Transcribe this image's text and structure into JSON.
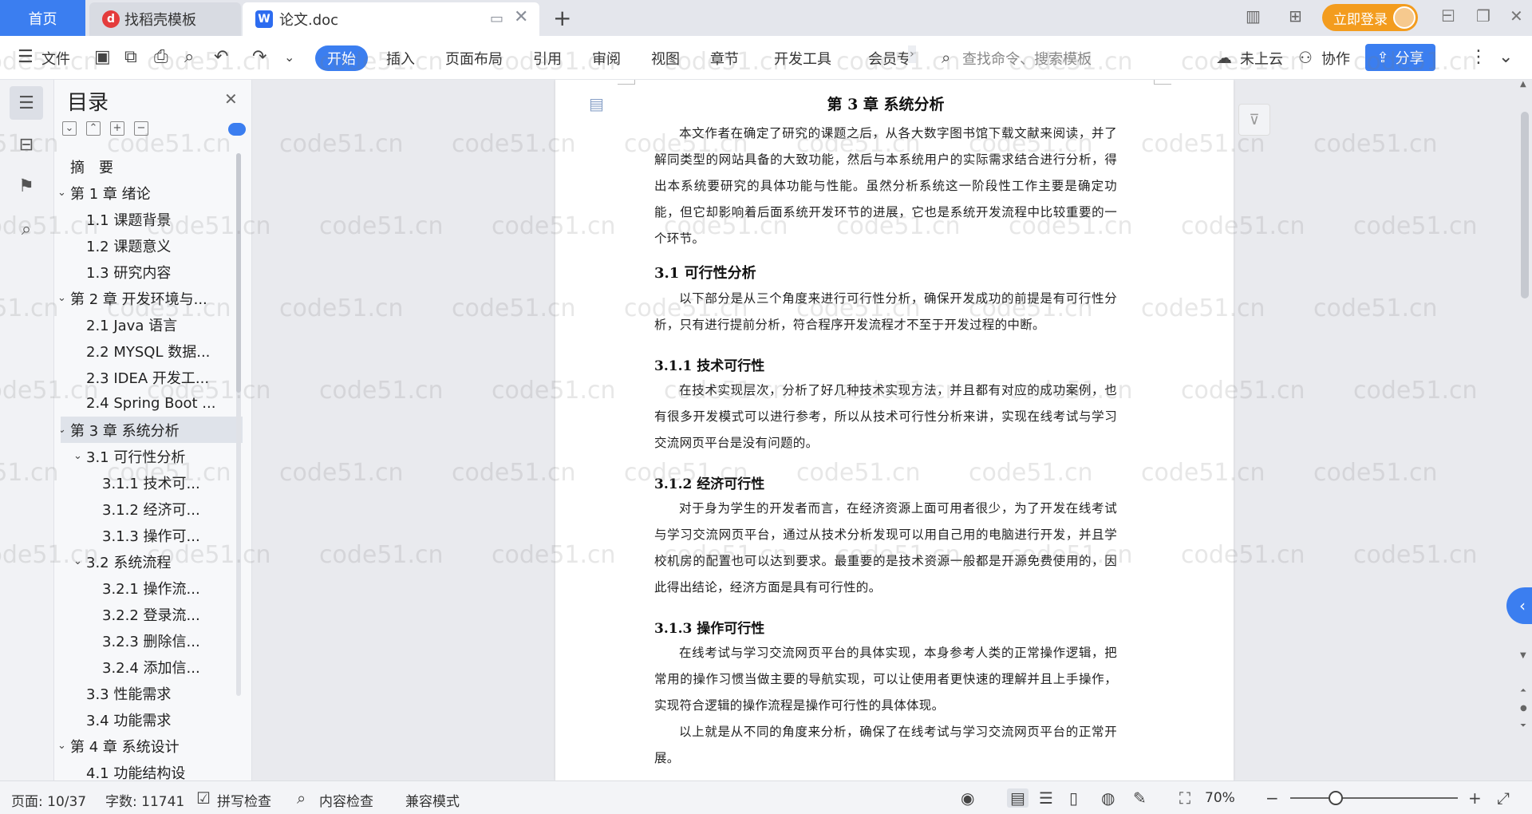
{
  "tabs": {
    "home": "首页",
    "templates": "找稻壳模板",
    "document": "论文.doc",
    "login": "立即登录"
  },
  "ribbon": {
    "file": "文件",
    "start": "开始",
    "menu": [
      "插入",
      "页面布局",
      "引用",
      "审阅",
      "视图",
      "章节",
      "开发工具",
      "会员专"
    ],
    "search_placeholder": "查找命令、搜索模板",
    "cloud": "未上云",
    "collab": "协作",
    "share": "分享"
  },
  "outline": {
    "title": "目录",
    "items": [
      {
        "label": "摘　要",
        "level": 1,
        "caret": false
      },
      {
        "label": "第 1 章  绪论",
        "level": 1,
        "caret": true
      },
      {
        "label": "1.1  课题背景",
        "level": 2,
        "caret": false
      },
      {
        "label": "1.2  课题意义",
        "level": 2,
        "caret": false
      },
      {
        "label": "1.3  研究内容",
        "level": 2,
        "caret": false
      },
      {
        "label": "第 2 章  开发环境与...",
        "level": 1,
        "caret": true
      },
      {
        "label": "2.1 Java 语言",
        "level": 2,
        "caret": false
      },
      {
        "label": "2.2 MYSQL 数据...",
        "level": 2,
        "caret": false
      },
      {
        "label": "2.3 IDEA 开发工...",
        "level": 2,
        "caret": false
      },
      {
        "label": "2.4 Spring Boot ...",
        "level": 2,
        "caret": false
      },
      {
        "label": "第 3 章  系统分析",
        "level": 1,
        "caret": true,
        "active": true
      },
      {
        "label": "3.1  可行性分析",
        "level": 2,
        "caret": true
      },
      {
        "label": "3.1.1  技术可...",
        "level": 3,
        "caret": false
      },
      {
        "label": "3.1.2  经济可...",
        "level": 3,
        "caret": false
      },
      {
        "label": "3.1.3  操作可...",
        "level": 3,
        "caret": false
      },
      {
        "label": "3.2  系统流程",
        "level": 2,
        "caret": true
      },
      {
        "label": "3.2.1  操作流...",
        "level": 3,
        "caret": false
      },
      {
        "label": "3.2.2  登录流...",
        "level": 3,
        "caret": false
      },
      {
        "label": "3.2.3  删除信...",
        "level": 3,
        "caret": false
      },
      {
        "label": "3.2.4  添加信...",
        "level": 3,
        "caret": false
      },
      {
        "label": "3.3  性能需求",
        "level": 2,
        "caret": false
      },
      {
        "label": "3.4  功能需求",
        "level": 2,
        "caret": false
      },
      {
        "label": "第 4 章  系统设计",
        "level": 1,
        "caret": true
      },
      {
        "label": "4.1  功能结构设",
        "level": 2,
        "caret": false
      }
    ]
  },
  "document": {
    "chapter_title": "第 3 章  系统分析",
    "intro": "本文作者在确定了研究的课题之后，从各大数字图书馆下载文献来阅读，并了解同类型的网站具备的大致功能，然后与本系统用户的实际需求结合进行分析，得出本系统要研究的具体功能与性能。虽然分析系统这一阶段性工作主要是确定功能，但它却影响着后面系统开发环节的进展，它也是系统开发流程中比较重要的一个环节。",
    "s31_title": "3.1  可行性分析",
    "s31_text": "以下部分是从三个角度来进行可行性分析，确保开发成功的前提是有可行性分析，只有进行提前分析，符合程序开发流程才不至于开发过程的中断。",
    "s311_title": "3.1.1  技术可行性",
    "s311_text": "在技术实现层次，分析了好几种技术实现方法，并且都有对应的成功案例，也有很多开发模式可以进行参考，所以从技术可行性分析来讲，实现在线考试与学习交流网页平台是没有问题的。",
    "s312_title": "3.1.2  经济可行性",
    "s312_text": "对于身为学生的开发者而言，在经济资源上面可用者很少，为了开发在线考试与学习交流网页平台，通过从技术分析发现可以用自己用的电脑进行开发，并且学校机房的配置也可以达到要求。最重要的是技术资源一般都是开源免费使用的，因此得出结论，经济方面是具有可行性的。",
    "s313_title": "3.1.3  操作可行性",
    "s313_text": "在线考试与学习交流网页平台的具体实现，本身参考人类的正常操作逻辑，把常用的操作习惯当做主要的导航实现，可以让使用者更快速的理解并且上手操作，实现符合逻辑的操作流程是操作可行性的具体体现。",
    "closing": "以上就是从不同的角度来分析，确保了在线考试与学习交流网页平台的正常开展。"
  },
  "watermark": "code51.cn",
  "status": {
    "page": "页面: 10/37",
    "words": "字数: 11741",
    "spell": "拼写检查",
    "content": "内容检查",
    "compat": "兼容模式",
    "zoom": "70%",
    "zoom_level": 0.27
  },
  "colors": {
    "accent": "#3b7ef0",
    "login": "#f39c1e"
  }
}
